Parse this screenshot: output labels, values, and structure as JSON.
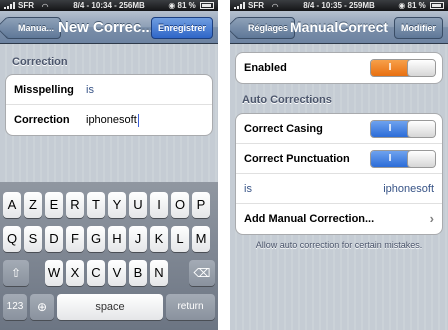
{
  "left": {
    "status": {
      "carrier": "SFR",
      "time": "8/4 - 10:34 - 256MB",
      "battery": "81 %"
    },
    "nav": {
      "back_label": "Manua...",
      "title": "New Correc...",
      "action_label": "Enregistrer"
    },
    "section_title": "Correction",
    "fields": [
      {
        "label": "Misspelling",
        "value": "is"
      },
      {
        "label": "Correction",
        "value": "iphonesoft"
      }
    ],
    "keyboard": {
      "row1": [
        "A",
        "Z",
        "E",
        "R",
        "T",
        "Y",
        "U",
        "I",
        "O",
        "P"
      ],
      "row2": [
        "Q",
        "S",
        "D",
        "F",
        "G",
        "H",
        "J",
        "K",
        "L",
        "M"
      ],
      "row3": [
        "W",
        "X",
        "C",
        "V",
        "B",
        "N"
      ],
      "bottom": {
        "numbers": "123",
        "space": "space",
        "return": "return"
      }
    }
  },
  "right": {
    "status": {
      "carrier": "SFR",
      "time": "8/4 - 10:35 - 259MB",
      "battery": "81 %"
    },
    "nav": {
      "back_label": "Réglages",
      "title": "ManualCorrect",
      "action_label": "Modifier"
    },
    "enabled": {
      "label": "Enabled",
      "on": "I"
    },
    "section_title": "Auto Corrections",
    "correct_casing": {
      "label": "Correct Casing",
      "on": "I"
    },
    "correct_punctuation": {
      "label": "Correct Punctuation",
      "on": "I"
    },
    "entry": {
      "from": "is",
      "to": "iphonesoft"
    },
    "add_label": "Add Manual Correction...",
    "footer": "Allow auto correction for certain mistakes.",
    "colors": {
      "orange_toggle": "#f07e1c",
      "blue_toggle": "#3f7fe0"
    }
  }
}
